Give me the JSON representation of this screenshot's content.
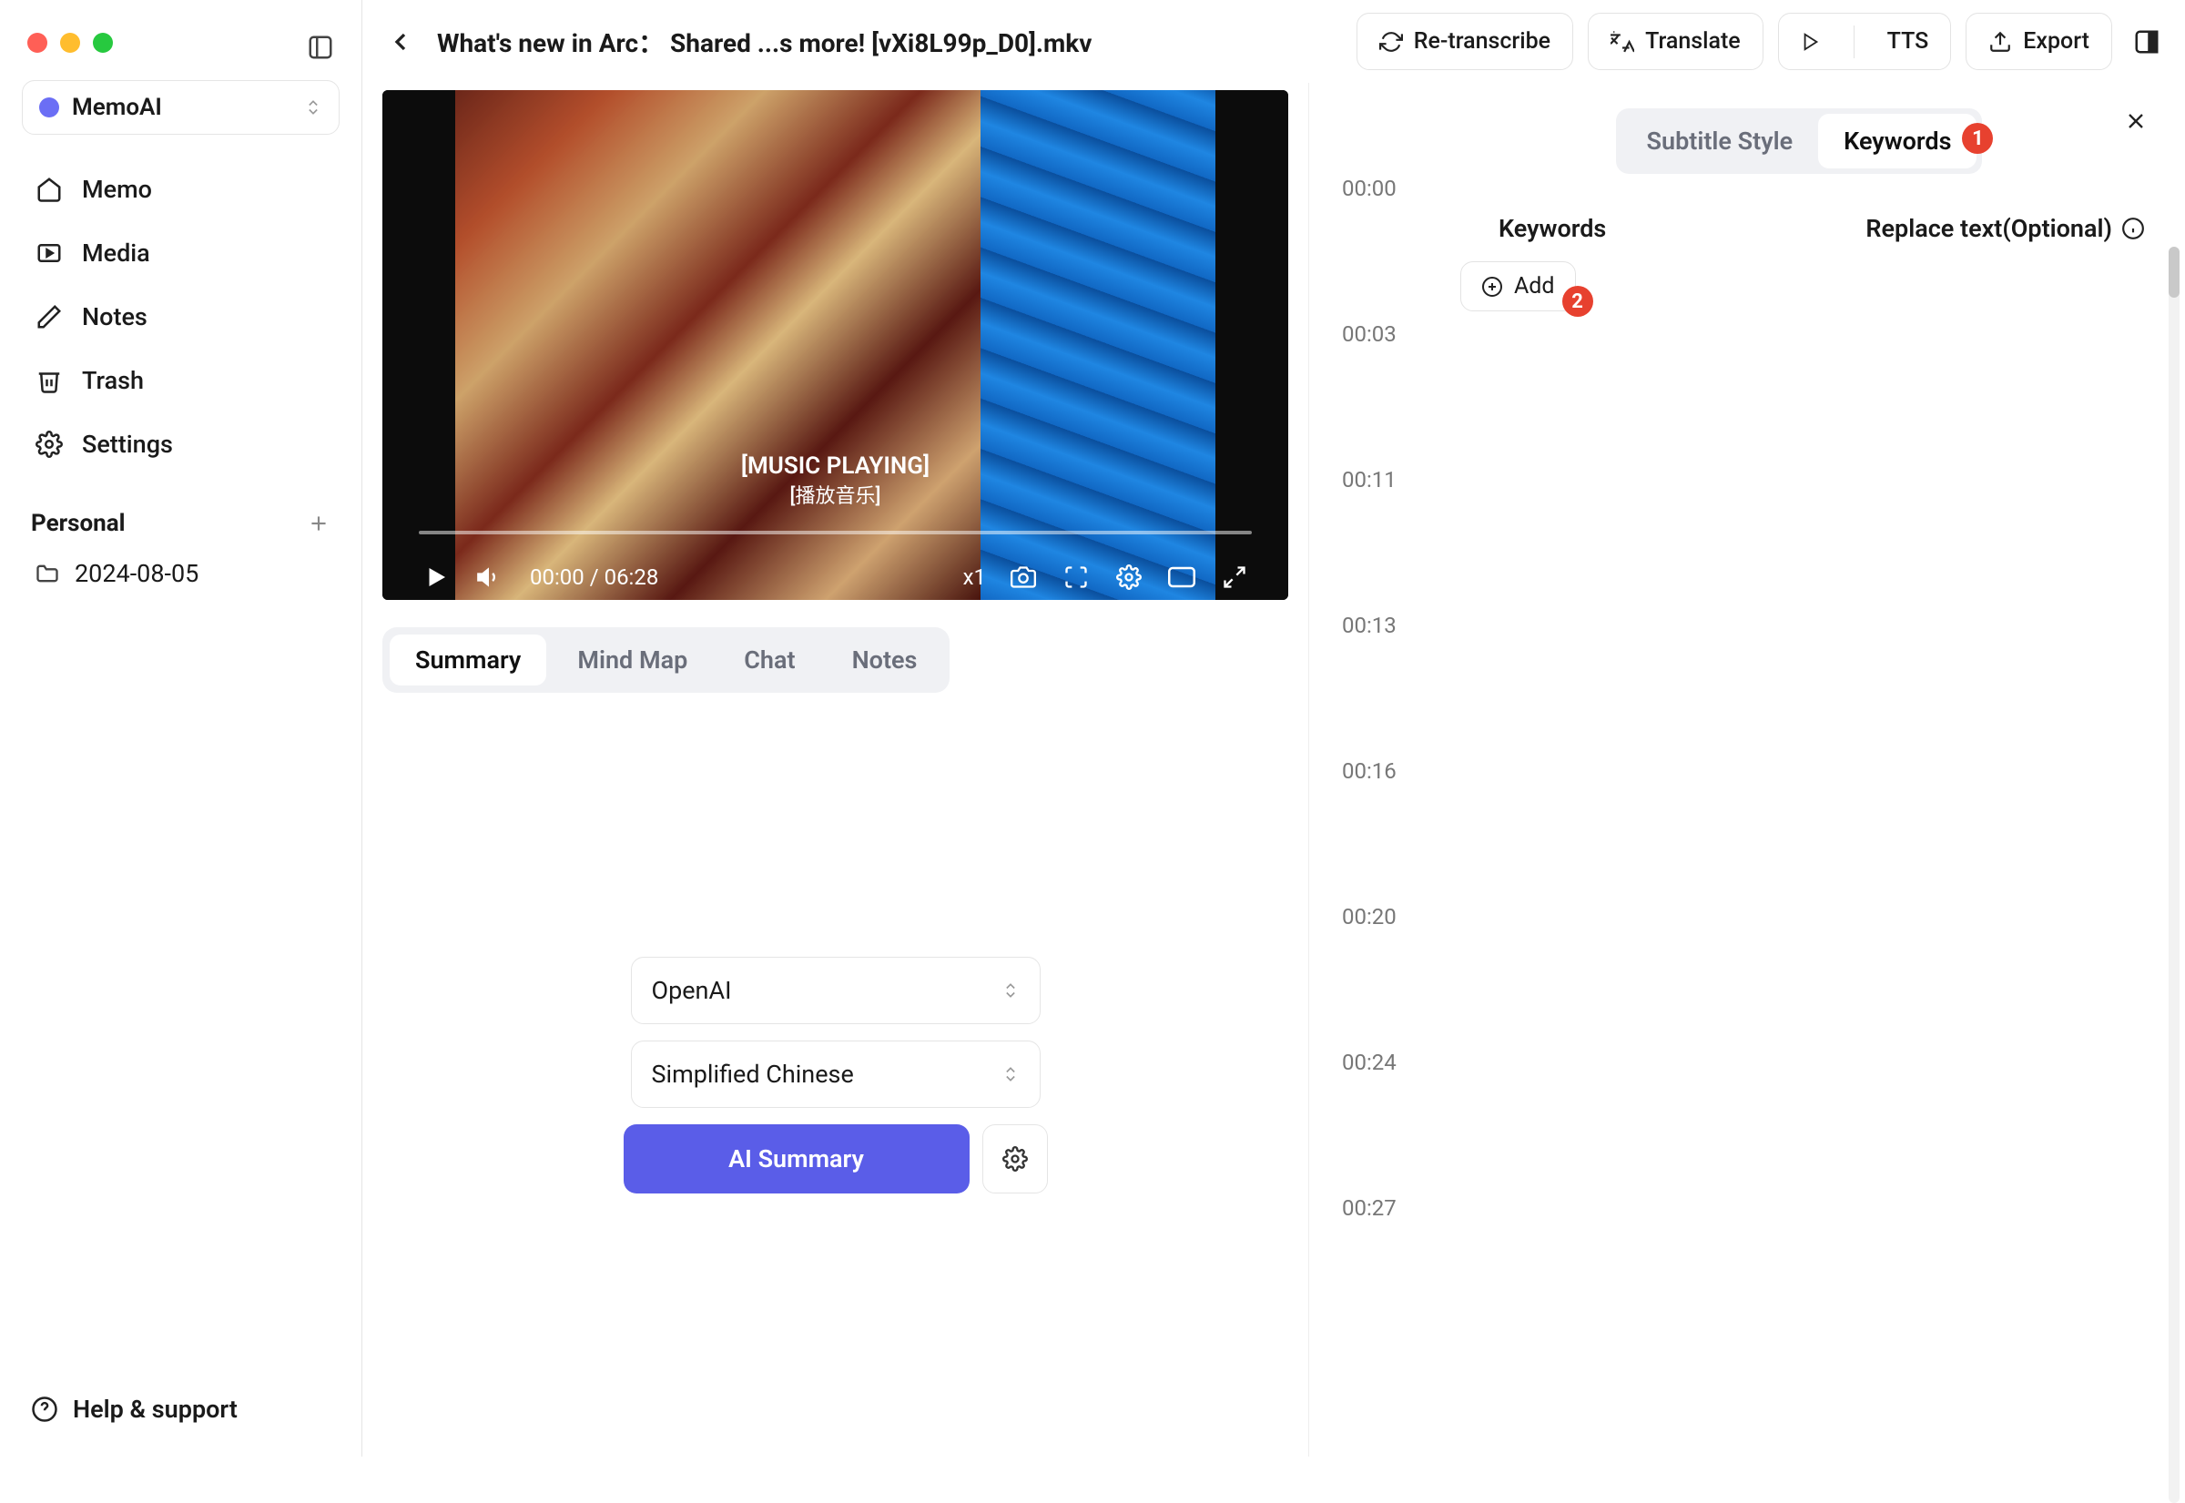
{
  "workspace": {
    "name": "MemoAI"
  },
  "nav": {
    "memo": "Memo",
    "media": "Media",
    "notes": "Notes",
    "trash": "Trash",
    "settings": "Settings"
  },
  "personal": {
    "heading": "Personal",
    "folder": "2024-08-05"
  },
  "help": {
    "label": "Help & support"
  },
  "topbar": {
    "title": "What's new in Arc： Shared ...s more! [vXi8L99p_D0].mkv",
    "retranscribe": "Re-transcribe",
    "translate": "Translate",
    "tts": "TTS",
    "export": "Export"
  },
  "video": {
    "subtitle_main": "[MUSIC PLAYING]",
    "subtitle_sub": "[播放音乐]",
    "current_time": "00:00",
    "duration": "06:28",
    "speed": "x1"
  },
  "tabs": {
    "summary": "Summary",
    "mindmap": "Mind Map",
    "chat": "Chat",
    "notes": "Notes"
  },
  "summary": {
    "model": "OpenAI",
    "language": "Simplified Chinese",
    "button": "AI Summary"
  },
  "transcript": {
    "timestamps": [
      "00:00",
      "00:03",
      "00:11",
      "00:13",
      "00:16",
      "00:20",
      "00:24",
      "00:27"
    ]
  },
  "kw_panel": {
    "tab_style": "Subtitle Style",
    "tab_keywords": "Keywords",
    "badge1": "1",
    "col_keywords": "Keywords",
    "col_replace": "Replace text(Optional)",
    "add": "Add",
    "badge2": "2"
  }
}
